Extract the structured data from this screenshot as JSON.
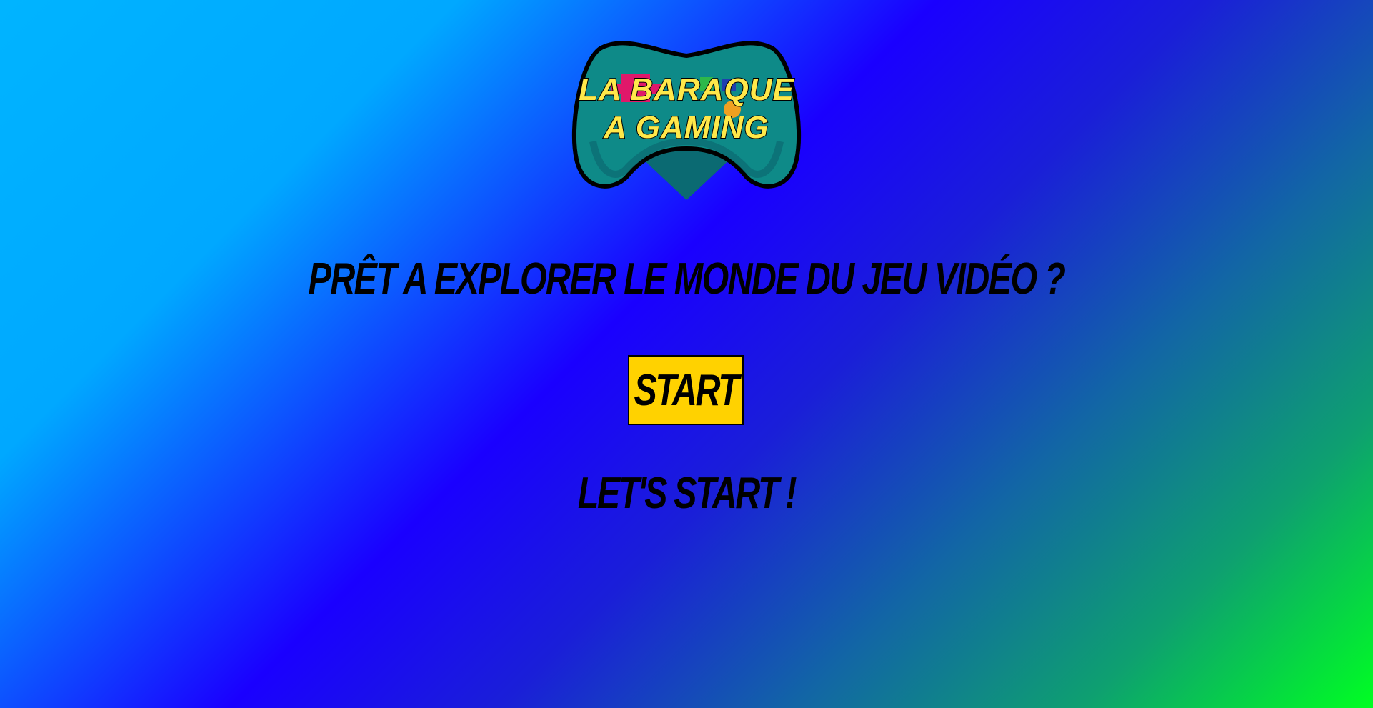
{
  "logo": {
    "line1": "LA BARAQUE",
    "line2": "A GAMING",
    "icon": "gamepad-icon",
    "colors": {
      "pad_body": "#0e8a88",
      "pad_shadow": "#0b6a72",
      "text_fill": "#ffe84a",
      "outline": "#000000"
    }
  },
  "headline": "PRÊT A EXPLORER LE MONDE DU JEU VIDÉO ?",
  "start_button": {
    "label": "START",
    "color": "#ffd200"
  },
  "subheadline": "LET'S START !"
}
